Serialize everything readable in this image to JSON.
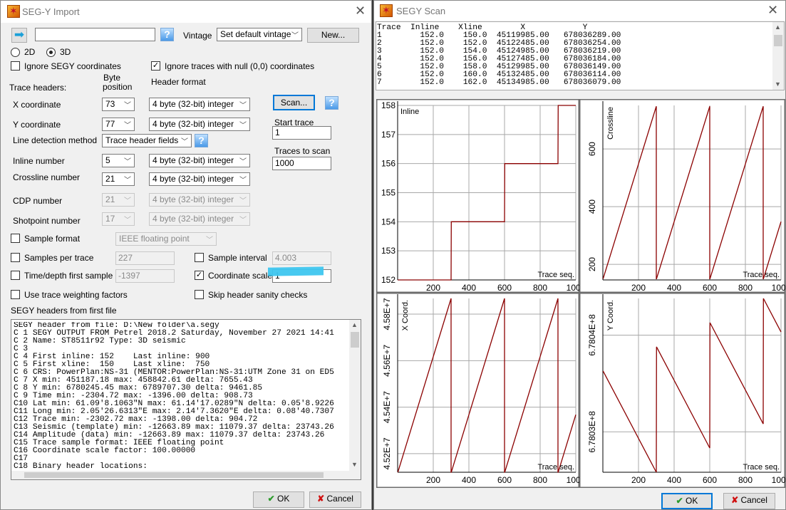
{
  "import_window": {
    "title": "SEG-Y Import",
    "file_path": "",
    "vintage_label": "Vintage",
    "vintage_value": "Set default vintage",
    "new_button": "New...",
    "dimension": {
      "option_2d": "2D",
      "option_3d": "3D",
      "selected": "3D"
    },
    "ignore_segy_coords": {
      "label": "Ignore SEGY coordinates",
      "checked": false
    },
    "ignore_null_traces": {
      "label": "Ignore traces with null (0,0) coordinates",
      "checked": true
    },
    "col_byte_1": "Byte",
    "col_byte_2": "position",
    "col_header_format": "Header format",
    "trace_headers_label": "Trace headers:",
    "rows": {
      "x": {
        "label": "X coordinate",
        "byte": "73",
        "format": "4 byte (32-bit) integer",
        "enabled": true
      },
      "y": {
        "label": "Y coordinate",
        "byte": "77",
        "format": "4 byte (32-bit) integer",
        "enabled": true
      },
      "inline": {
        "label": "Inline number",
        "byte": "5",
        "format": "4 byte (32-bit) integer",
        "enabled": true
      },
      "crossline": {
        "label": "Crossline number",
        "byte": "21",
        "format": "4 byte (32-bit) integer",
        "enabled": true
      },
      "cdp": {
        "label": "CDP number",
        "byte": "21",
        "format": "4 byte (32-bit) integer",
        "enabled": false
      },
      "shotpoint": {
        "label": "Shotpoint number",
        "byte": "17",
        "format": "4 byte (32-bit) integer",
        "enabled": false
      }
    },
    "line_detection": {
      "label": "Line detection method",
      "value": "Trace header fields"
    },
    "scan_button": "Scan...",
    "start_trace": {
      "label": "Start trace",
      "value": "1"
    },
    "traces_to_scan": {
      "label": "Traces to scan",
      "value": "1000"
    },
    "sample_format": {
      "label": "Sample format",
      "checked": false,
      "value": "IEEE floating point"
    },
    "samples_per_trace": {
      "label": "Samples per trace",
      "checked": false,
      "value": "227"
    },
    "sample_interval": {
      "label": "Sample interval",
      "checked": false,
      "value": "4.003"
    },
    "time_first_sample": {
      "label": "Time/depth first sample",
      "checked": false,
      "value": "-1397"
    },
    "coordinate_scale": {
      "label": "Coordinate scale",
      "checked": true,
      "value": "1"
    },
    "trace_weighting": {
      "label": "Use trace weighting factors",
      "checked": false
    },
    "skip_sanity": {
      "label": "Skip header sanity checks",
      "checked": false
    },
    "headers_title": "SEGY headers from first file",
    "header_lines": [
      "SEGY header from file: D:\\New folder\\a.segy",
      "C 1 SEGY OUTPUT FROM Petrel 2018.2 Saturday, November 27 2021 14:41",
      "C 2 Name: ST8511r92 Type: 3D seismic",
      "C 3",
      "C 4 First inline: 152    Last inline: 900",
      "C 5 First xline:  150    Last xline:  750",
      "C 6 CRS: PowerPlan:NS-31 (MENTOR:PowerPlan:NS-31:UTM Zone 31 on ED5",
      "C 7 X min: 451187.18 max: 458842.61 delta: 7655.43",
      "C 8 Y min: 6780245.45 max: 6789707.30 delta: 9461.85",
      "C 9 Time min: -2304.72 max: -1396.00 delta: 908.73",
      "C10 Lat min: 61.09'8.1063\"N max: 61.14'17.0289\"N delta: 0.05'8.9226",
      "C11 Long min: 2.05'26.6313\"E max: 2.14'7.3620\"E delta: 0.08'40.7307",
      "C12 Trace min: -2302.72 max: -1398.00 delta: 904.72",
      "C13 Seismic (template) min: -12663.89 max: 11079.37 delta: 23743.26",
      "C14 Amplitude (data) min: -12663.89 max: 11079.37 delta: 23743.26",
      "C15 Trace sample format: IEEE floating point",
      "C16 Coordinate scale factor: 100.00000",
      "C17",
      "C18 Binary header locations:"
    ],
    "ok": "OK",
    "cancel": "Cancel"
  },
  "scan_window": {
    "title": "SEGY Scan",
    "header_row": "Trace  Inline    Xline        X            Y",
    "rows": [
      "1        152.0    150.0  45119985.00   678036289.00",
      "2        152.0    152.0  45122485.00   678036254.00",
      "3        152.0    154.0  45124985.00   678036219.00",
      "4        152.0    156.0  45127485.00   678036184.00",
      "5        152.0    158.0  45129985.00   678036149.00",
      "6        152.0    160.0  45132485.00   678036114.00",
      "7        152.0    162.0  45134985.00   678036079.00"
    ],
    "ok": "OK",
    "cancel": "Cancel"
  },
  "colors": {
    "series": "#8b0000",
    "grid": "#a8a8a8",
    "highlight": "#3ec6ef",
    "focus": "#0078d7"
  },
  "chart_data": [
    {
      "type": "line",
      "ylabel": "Inline",
      "xlabel": "Trace seq.",
      "ylabel_orientation": "horizontal",
      "xlim": [
        0,
        1000
      ],
      "ylim": [
        152,
        158
      ],
      "grid": true,
      "x": [
        1,
        300,
        301,
        600,
        601,
        900,
        901,
        1000
      ],
      "y": [
        152,
        152,
        154,
        154,
        156,
        156,
        158,
        158
      ],
      "xticks": [
        {
          "value": 200,
          "label": "200"
        },
        {
          "value": 400,
          "label": "400"
        },
        {
          "value": 600,
          "label": "600"
        },
        {
          "value": 800,
          "label": "800"
        },
        {
          "value": 1000,
          "label": "1000"
        }
      ],
      "yticks": [
        {
          "value": 152,
          "label": "152"
        },
        {
          "value": 153,
          "label": "153"
        },
        {
          "value": 154,
          "label": "154"
        },
        {
          "value": 155,
          "label": "155"
        },
        {
          "value": 156,
          "label": "156"
        },
        {
          "value": 157,
          "label": "157"
        },
        {
          "value": 158,
          "label": "158"
        }
      ]
    },
    {
      "type": "line",
      "ylabel": "Crossline",
      "xlabel": "Trace seq.",
      "ylabel_orientation": "vertical",
      "xlim": [
        0,
        1000
      ],
      "ylim": [
        146,
        751
      ],
      "grid": true,
      "x": [
        1,
        300,
        300,
        301,
        600,
        600,
        601,
        900,
        900,
        901,
        1000
      ],
      "y": [
        150,
        748,
        150,
        150,
        748,
        150,
        150,
        748,
        150,
        150,
        348
      ],
      "xticks": [
        {
          "value": 200,
          "label": "200"
        },
        {
          "value": 400,
          "label": "400"
        },
        {
          "value": 600,
          "label": "600"
        },
        {
          "value": 800,
          "label": "800"
        },
        {
          "value": 1000,
          "label": "1000"
        }
      ],
      "yticks": [
        {
          "value": 200,
          "label": "200"
        },
        {
          "value": 400,
          "label": "400"
        },
        {
          "value": 600,
          "label": "600"
        }
      ]
    },
    {
      "type": "line",
      "ylabel": "X Coord.",
      "xlabel": "Trace seq.",
      "ylabel_orientation": "vertical",
      "xlim": [
        0,
        1000
      ],
      "ylim": [
        45119985,
        45867485
      ],
      "grid": true,
      "x": [
        1,
        300,
        300,
        301,
        600,
        600,
        601,
        900,
        900,
        901,
        1000
      ],
      "y": [
        45119985,
        45867485,
        45119985,
        45119985,
        45867485,
        45119985,
        45119985,
        45867485,
        45119985,
        45119985,
        45367485
      ],
      "xticks": [
        {
          "value": 200,
          "label": "200"
        },
        {
          "value": 400,
          "label": "400"
        },
        {
          "value": 600,
          "label": "600"
        },
        {
          "value": 800,
          "label": "800"
        },
        {
          "value": 1000,
          "label": "1000"
        }
      ],
      "yticks": [
        {
          "value": 45200000,
          "label": "4.52E+7"
        },
        {
          "value": 45400000,
          "label": "4.54E+7"
        },
        {
          "value": 45600000,
          "label": "4.56E+7"
        },
        {
          "value": 45800000,
          "label": "4.58E+7"
        }
      ]
    },
    {
      "type": "line",
      "ylabel": "Y Coord.",
      "xlabel": "Trace seq.",
      "ylabel_orientation": "vertical",
      "xlim": [
        0,
        1000
      ],
      "ylim": [
        678025824,
        678043789
      ],
      "grid": true,
      "x": [
        1,
        300,
        301,
        600,
        601,
        900,
        901,
        1000
      ],
      "y": [
        678036289,
        678025824,
        678038789,
        678028324,
        678041289,
        678030824,
        678043789,
        678040324
      ],
      "xticks": [
        {
          "value": 200,
          "label": "200"
        },
        {
          "value": 400,
          "label": "400"
        },
        {
          "value": 600,
          "label": "600"
        },
        {
          "value": 800,
          "label": "800"
        },
        {
          "value": 1000,
          "label": "1000"
        }
      ],
      "yticks": [
        {
          "value": 678030000,
          "label": "6.7803E+8"
        },
        {
          "value": 678040000,
          "label": "6.7804E+8"
        }
      ]
    }
  ]
}
